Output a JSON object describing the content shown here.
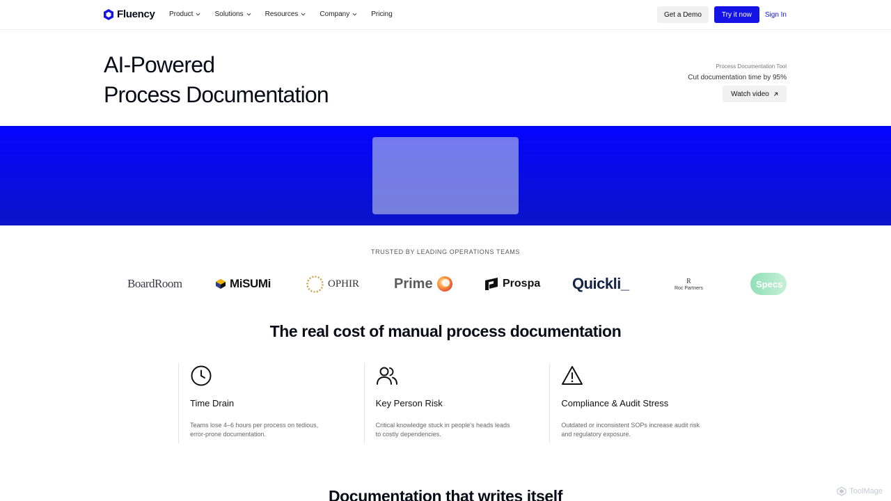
{
  "nav": {
    "brand": "Fluency",
    "links": [
      {
        "label": "Product",
        "dropdown": true
      },
      {
        "label": "Solutions",
        "dropdown": true
      },
      {
        "label": "Resources",
        "dropdown": true
      },
      {
        "label": "Company",
        "dropdown": true
      },
      {
        "label": "Pricing",
        "dropdown": false
      }
    ],
    "demo_label": "Get a Demo",
    "try_label": "Try it now",
    "signin_label": "Sign In"
  },
  "hero": {
    "title_line1": "AI-Powered",
    "title_line2": "Process Documentation",
    "tag": "Process Documentation Tool",
    "subtitle": "Cut documentation time by 95%",
    "watch_label": "Watch video"
  },
  "trusted": {
    "heading": "TRUSTED BY LEADING OPERATIONS TEAMS",
    "logos": {
      "boardroom": "BoardRoom",
      "misumi": "MiSUMi",
      "ophir": "OPHIR",
      "prime": "Prime",
      "prospa": "Prospa",
      "quickli": "Quickli_",
      "roc_mark": "R",
      "roc": "Roc Partners",
      "specs": "Specs"
    }
  },
  "cost": {
    "title": "The real cost of manual process documentation",
    "cards": [
      {
        "icon": "clock-icon",
        "title": "Time Drain",
        "desc": "Teams lose 4–6 hours per process on tedious, error-prone documentation."
      },
      {
        "icon": "users-icon",
        "title": "Key Person Risk",
        "desc": "Critical knowledge stuck in people's heads leads to costly dependencies."
      },
      {
        "icon": "warning-icon",
        "title": "Compliance & Audit Stress",
        "desc": "Outdated or inconsistent SOPs increase audit risk and regulatory exposure."
      }
    ]
  },
  "next_section": {
    "title": "Documentation that writes itself"
  },
  "watermark": "ToolMage",
  "colors": {
    "accent": "#1414e6",
    "banner_top": "#0505ff",
    "banner_bottom": "#0a14c8"
  }
}
